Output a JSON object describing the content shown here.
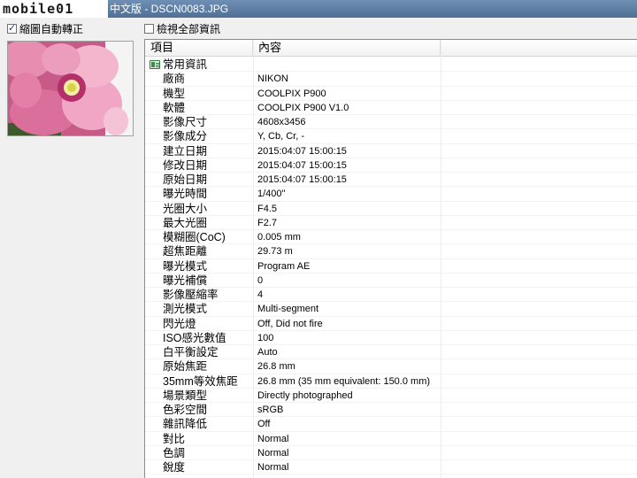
{
  "window": {
    "logo_text": "mobile01",
    "title": "中文版 - DSCN0083.JPG"
  },
  "options": {
    "auto_rotate_label": "縮圖自動轉正",
    "auto_rotate_checked": true,
    "show_all_label": "檢視全部資訊",
    "show_all_checked": false
  },
  "table": {
    "col_item": "項目",
    "col_content": "內容",
    "group_label": "常用資訊",
    "rows": [
      {
        "key": "廠商",
        "value": "NIKON"
      },
      {
        "key": "機型",
        "value": "COOLPIX P900"
      },
      {
        "key": "軟體",
        "value": "COOLPIX P900   V1.0"
      },
      {
        "key": "影像尺寸",
        "value": "4608x3456"
      },
      {
        "key": "影像成分",
        "value": "Y, Cb, Cr, -"
      },
      {
        "key": "建立日期",
        "value": "2015:04:07 15:00:15"
      },
      {
        "key": "修改日期",
        "value": "2015:04:07 15:00:15"
      },
      {
        "key": "原始日期",
        "value": "2015:04:07 15:00:15"
      },
      {
        "key": "曝光時間",
        "value": "1/400\""
      },
      {
        "key": "光圈大小",
        "value": "F4.5"
      },
      {
        "key": "最大光圈",
        "value": "F2.7"
      },
      {
        "key": "模糊圈(CoC)",
        "value": "0.005 mm"
      },
      {
        "key": "超焦距離",
        "value": "29.73 m"
      },
      {
        "key": "曝光模式",
        "value": "Program AE"
      },
      {
        "key": "曝光補償",
        "value": "0"
      },
      {
        "key": "影像壓縮率",
        "value": "4"
      },
      {
        "key": "測光模式",
        "value": "Multi-segment"
      },
      {
        "key": "閃光燈",
        "value": "Off, Did not fire"
      },
      {
        "key": "ISO感光數值",
        "value": "100"
      },
      {
        "key": "白平衡設定",
        "value": "Auto"
      },
      {
        "key": "原始焦距",
        "value": "26.8 mm"
      },
      {
        "key": "35mm等效焦距",
        "value": "26.8 mm (35 mm equivalent: 150.0 mm)"
      },
      {
        "key": "場景類型",
        "value": "Directly photographed"
      },
      {
        "key": "色彩空間",
        "value": "sRGB"
      },
      {
        "key": "雜訊降低",
        "value": "Off"
      },
      {
        "key": "對比",
        "value": "Normal"
      },
      {
        "key": "色調",
        "value": "Normal"
      },
      {
        "key": "銳度",
        "value": "Normal"
      }
    ]
  }
}
